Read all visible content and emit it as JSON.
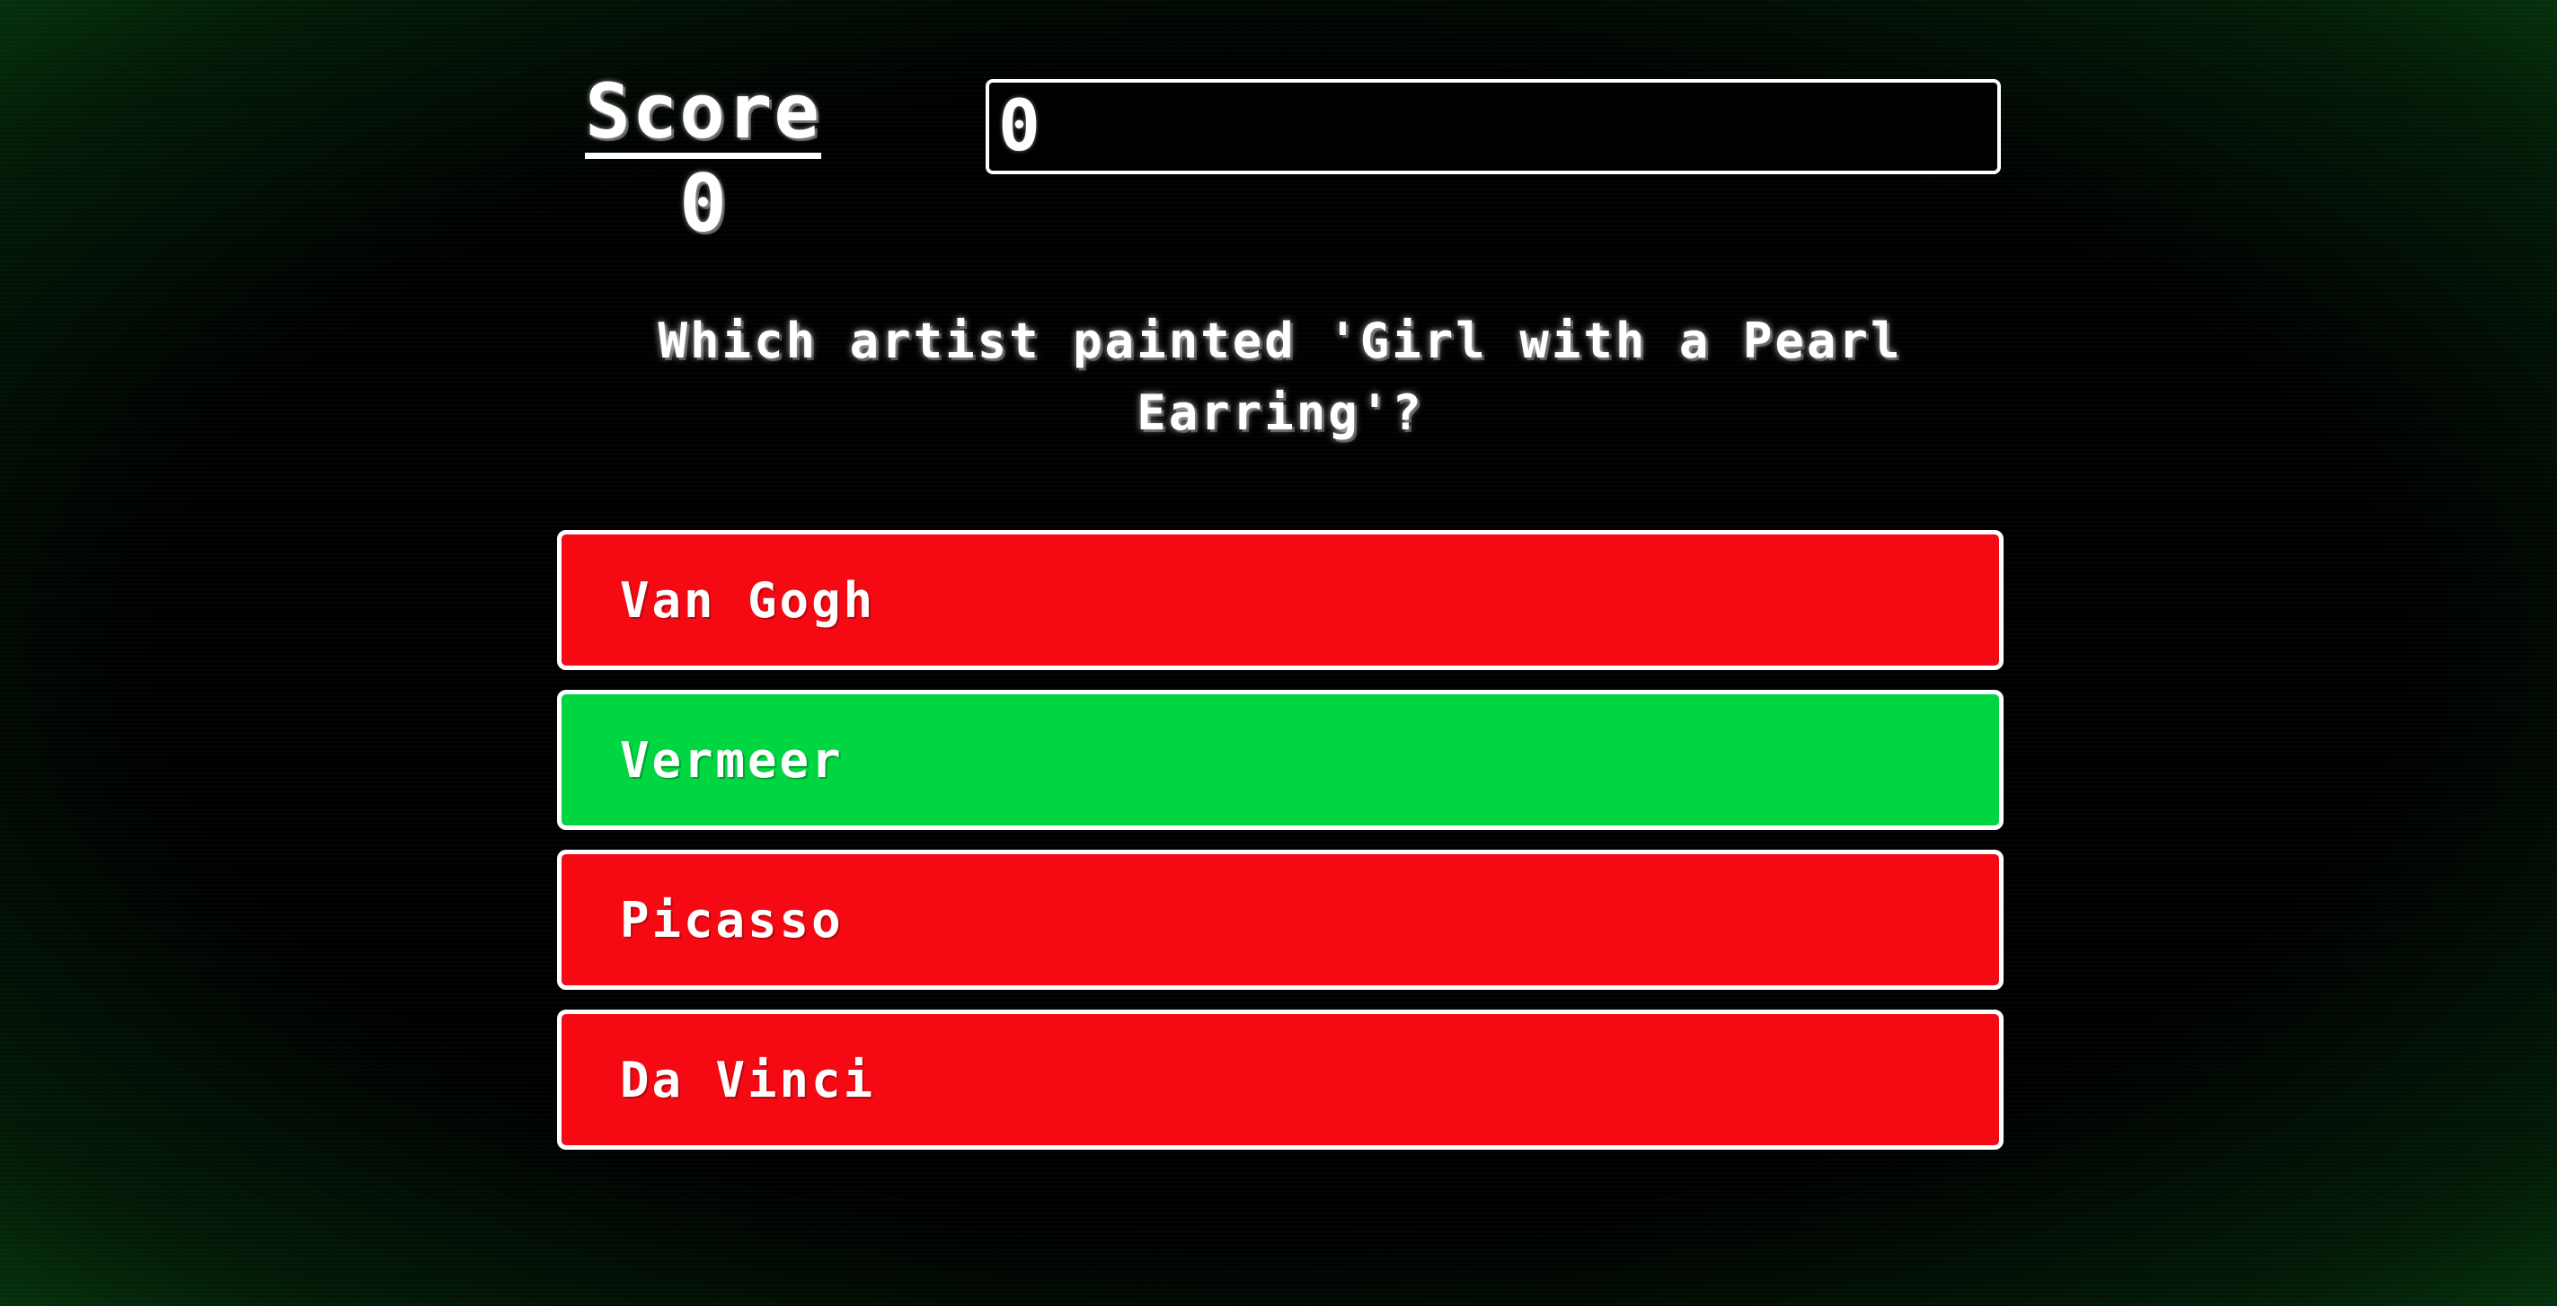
{
  "score": {
    "label": "Score",
    "value": "0"
  },
  "answer_input": {
    "value": "0"
  },
  "question": {
    "text": "Which artist painted 'Girl with a Pearl Earring'?"
  },
  "options": [
    {
      "label": "Van Gogh",
      "state": "wrong"
    },
    {
      "label": "Vermeer",
      "state": "correct"
    },
    {
      "label": "Picasso",
      "state": "wrong"
    },
    {
      "label": "Da Vinci",
      "state": "wrong"
    }
  ],
  "colors": {
    "background": "#000000",
    "wrong": "#f50a14",
    "correct": "#00d642",
    "text": "#ffffff"
  }
}
